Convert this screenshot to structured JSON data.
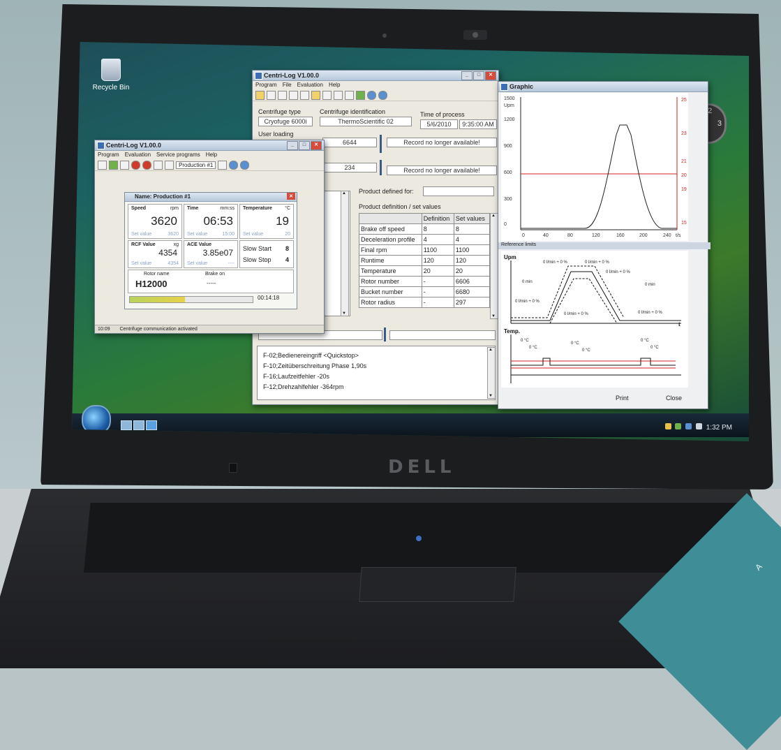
{
  "desktop": {
    "recycle_bin_label": "Recycle Bin",
    "tray_time": "1:32 PM"
  },
  "main_window": {
    "title": "Centri-Log V1.00.0",
    "menu": [
      "Program",
      "File",
      "Evaluation",
      "Help"
    ],
    "centrifuge_type_label": "Centrifuge type",
    "centrifuge_type_value": "Cryofuge 6000i",
    "centrifuge_id_label": "Centrifuge identification",
    "centrifuge_id_value": "ThermoScientific 02",
    "time_label": "Time of process",
    "date_value": "5/6/2010",
    "time_value": "9:35:00 AM",
    "user_label": "User loading",
    "row1_num": "6644",
    "row1_msg": "Record no longer available!",
    "row2_num": "234",
    "row2_msg": "Record no longer available!",
    "product_defined_label": "Product defined for:",
    "product_def_label": "Product definition / set values",
    "table_headers": [
      "",
      "Definition",
      "Set values"
    ],
    "table_rows": [
      [
        "Brake off speed",
        "8",
        "8"
      ],
      [
        "Deceleration profile",
        "4",
        "4"
      ],
      [
        "Final rpm",
        "1100",
        "1100"
      ],
      [
        "Runtime",
        "120",
        "120"
      ],
      [
        "Temperature",
        "20",
        "20"
      ],
      [
        "Rotor number",
        "-",
        "6606"
      ],
      [
        "Bucket number",
        "-",
        "6680"
      ],
      [
        "Rotor radius",
        "-",
        "297"
      ]
    ],
    "log_lines": [
      "F-02;Bedienereingriff <Quickstop>",
      "F-10;Zeitüberschreitung Phase 1,90s",
      "F-16;Laufzeitfehler -20s",
      "F-12;Drehzahlfehler -364rpm"
    ]
  },
  "small_window": {
    "title": "Centri-Log V1.00.0",
    "menu": [
      "Program",
      "Evaluation",
      "Service programs",
      "Help"
    ],
    "toolbar_select": "Production #1",
    "inner_title": "Name: Production #1",
    "speed_label": "Speed",
    "speed_unit": "rpm",
    "speed_value": "3620",
    "speed_set_label": "Set value",
    "speed_set_value": "3620",
    "time_label": "Time",
    "time_unit": "mm:ss",
    "time_value": "06:53",
    "time_set_label": "Set value",
    "time_set_value": "15:00",
    "temp_label": "Temperature",
    "temp_unit": "°C",
    "temp_value": "19",
    "temp_set_label": "Set value",
    "temp_set_value": "20",
    "rcf_label": "RCF Value",
    "rcf_unit": "xg",
    "rcf_value": "4354",
    "rcf_set_label": "Set value",
    "rcf_set_value": "4354",
    "ace_label": "ACE Value",
    "ace_value": "3.85e07",
    "ace_set_label": "Set value",
    "ace_set_value": "----",
    "slow_start_label": "Slow Start",
    "slow_start_value": "8",
    "slow_stop_label": "Slow Stop",
    "slow_stop_value": "4",
    "rotor_label": "Rotor name",
    "rotor_value": "H12000",
    "brake_label": "Brake on",
    "brake_value": "-----",
    "progress": 0.45,
    "elapsed": "00:14:18",
    "status_time": "10:09",
    "status_text": "Centrifuge communication activated"
  },
  "graphic_window": {
    "title": "Graphic",
    "y_ticks_left": [
      "1500",
      "1200",
      "900",
      "600",
      "300",
      "0"
    ],
    "y_unit_left": "Upm",
    "y_ticks_right": [
      "25",
      "23",
      "21",
      "20",
      "19",
      "15"
    ],
    "x_ticks": [
      "0",
      "40",
      "80",
      "120",
      "160",
      "200",
      "240"
    ],
    "x_unit": "t/s",
    "reference_label": "Reference limits",
    "ref_upm": "Upm",
    "ref_temp": "Temp.",
    "ref_t": "t",
    "ref_notes": [
      "0 l/min + 0 %",
      "0 l/min + 0 %",
      "0 l/min + 0 %",
      "0 min",
      "0 min",
      "0 l/min + 0 %",
      "0 l/min + 0 %",
      "0 l/min + 0 %"
    ],
    "temp_notes": [
      "0 °C",
      "0 °C",
      "0 °C",
      "0 °C",
      "0 °C",
      "0 °C"
    ],
    "print_label": "Print",
    "close_label": "Close"
  },
  "brand": "DELL",
  "accent_text": "A"
}
